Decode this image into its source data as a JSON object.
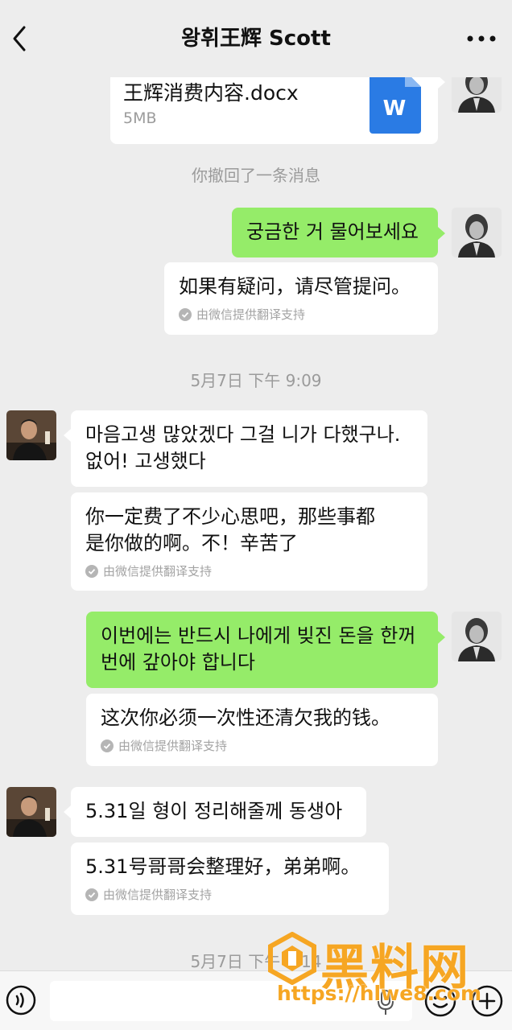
{
  "header": {
    "title": "왕휘王辉 Scott"
  },
  "file_message": {
    "name": "王辉消费内容.docx",
    "size": "5MB",
    "icon_letter": "W"
  },
  "recall_notice": "你撤回了一条消息",
  "messages": [
    {
      "text": "궁금한 거 물어보세요",
      "translation": "如果有疑问，请尽管提问。",
      "translation_note": "由微信提供翻译支持"
    },
    {
      "text": "마음고생 많았겠다 그걸 니가 다했구나.\n없어! 고생했다",
      "translation": "你一定费了不少心思吧，那些事都\n是你做的啊。不！辛苦了",
      "translation_note": "由微信提供翻译支持"
    },
    {
      "text": "이번에는 반드시 나에게 빚진 돈을 한꺼\n번에 갚아야 합니다",
      "translation": "这次你必须一次性还清欠我的钱。",
      "translation_note": "由微信提供翻译支持"
    },
    {
      "text": "5.31일 형이 정리해줄께 동생아",
      "translation": "5.31号哥哥会整理好，弟弟啊。",
      "translation_note": "由微信提供翻译支持"
    }
  ],
  "timestamps": [
    "5月7日 下午 9:09",
    "5月7日 下午 9:14"
  ],
  "watermark": {
    "brand": "黑料网",
    "url": "https://hlwe8.com"
  },
  "colors": {
    "background": "#ededed",
    "sent_bubble": "#95ec69",
    "received_bubble": "#ffffff",
    "watermark": "#f6a623",
    "word_icon": "#2a7be4"
  }
}
